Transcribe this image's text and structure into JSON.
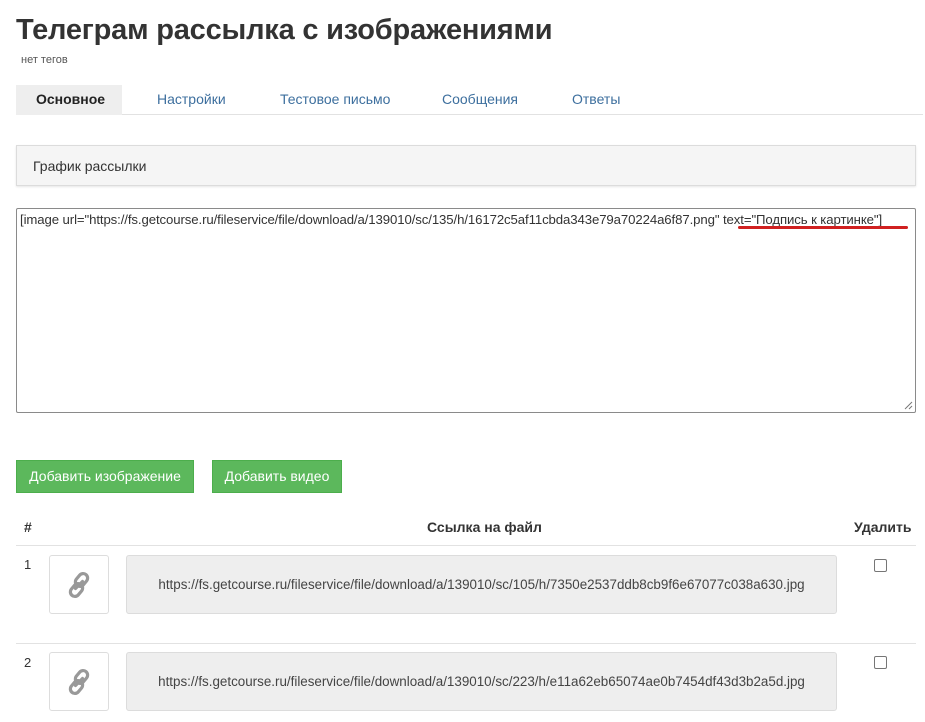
{
  "page": {
    "title": "Телеграм рассылка с изображениями",
    "tags": "нет тегов"
  },
  "tabs": [
    {
      "label": "Основное",
      "active": true
    },
    {
      "label": "Настройки",
      "active": false
    },
    {
      "label": "Тестовое письмо",
      "active": false
    },
    {
      "label": "Сообщения",
      "active": false
    },
    {
      "label": "Ответы",
      "active": false
    }
  ],
  "schedule_panel": {
    "label": "График рассылки"
  },
  "editor": {
    "content": "[image url=\"https://fs.getcourse.ru/fileservice/file/download/a/139010/sc/135/h/16172c5af11cbda343e79a70224a6f87.png\" text=\"Подпись к картинке\"]",
    "highlight_color": "#d02020"
  },
  "buttons": {
    "add_image": "Добавить изображение",
    "add_video": "Добавить видео",
    "color": "#5cb85c"
  },
  "table": {
    "headers": {
      "num": "#",
      "link": "Ссылка на файл",
      "delete": "Удалить"
    },
    "rows": [
      {
        "num": "1",
        "icon": "link-icon",
        "url": "https://fs.getcourse.ru/fileservice/file/download/a/139010/sc/105/h/7350e2537ddb8cb9f6e67077c038a630.jpg",
        "delete_checked": false
      },
      {
        "num": "2",
        "icon": "link-icon",
        "url": "https://fs.getcourse.ru/fileservice/file/download/a/139010/sc/223/h/e11a62eb65074ae0b7454df43d3b2a5d.jpg",
        "delete_checked": false
      }
    ]
  }
}
